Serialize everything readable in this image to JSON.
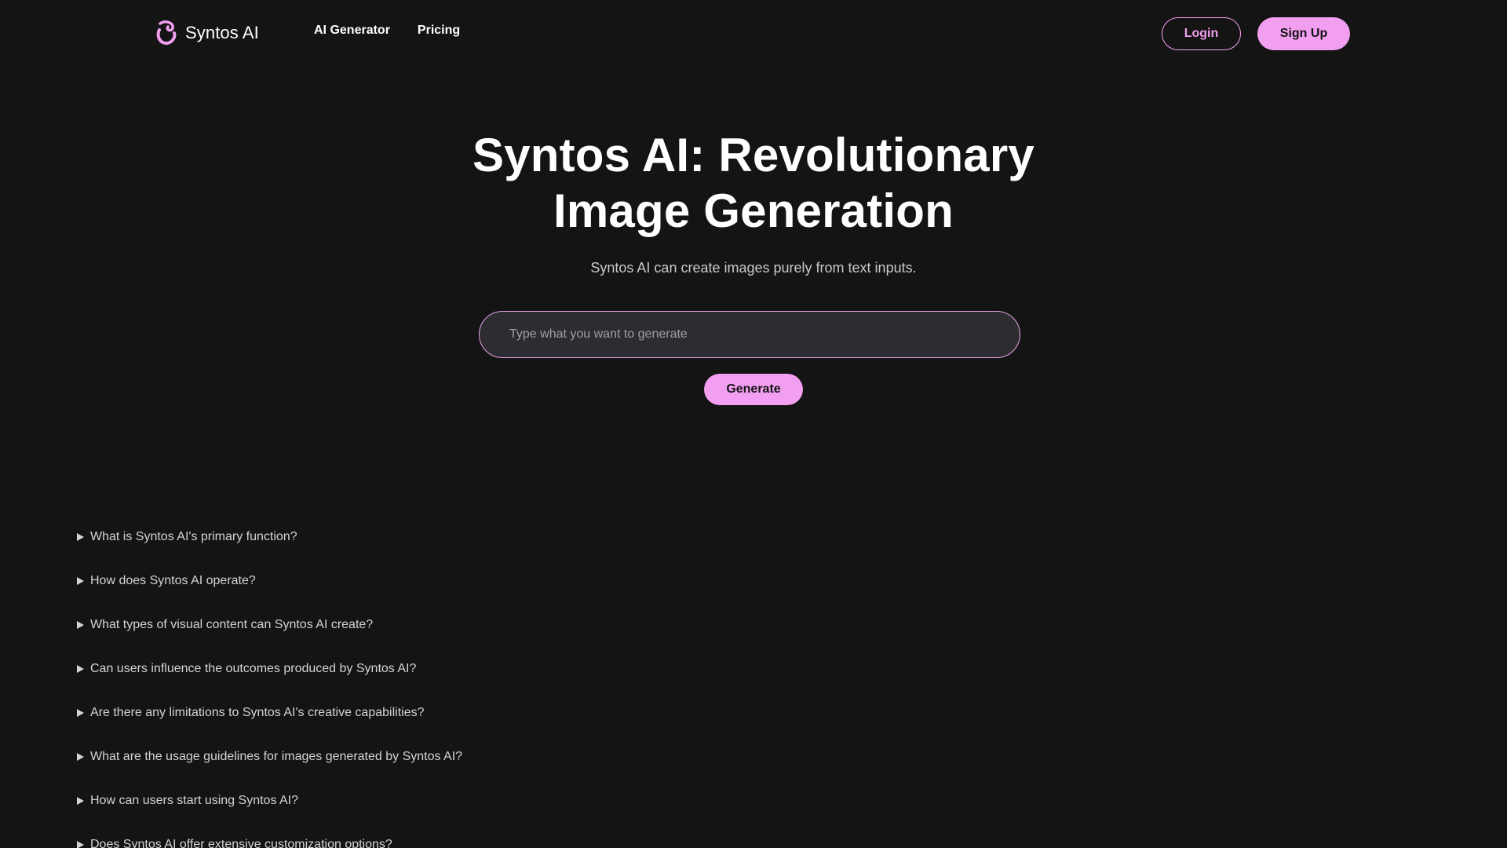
{
  "header": {
    "logo_text": "Syntos AI",
    "nav": [
      {
        "label": "AI Generator"
      },
      {
        "label": "Pricing"
      }
    ],
    "login_label": "Login",
    "signup_label": "Sign Up"
  },
  "hero": {
    "title_line1": "Syntos AI: Revolutionary",
    "title_line2": "Image Generation",
    "subtitle": "Syntos AI can create images purely from text inputs.",
    "prompt_placeholder": "Type what you want to generate",
    "prompt_value": "",
    "generate_label": "Generate"
  },
  "faq": [
    {
      "question": "What is Syntos AI's primary function?"
    },
    {
      "question": "How does Syntos AI operate?"
    },
    {
      "question": "What types of visual content can Syntos AI create?"
    },
    {
      "question": "Can users influence the outcomes produced by Syntos AI?"
    },
    {
      "question": "Are there any limitations to Syntos AI's creative capabilities?"
    },
    {
      "question": "What are the usage guidelines for images generated by Syntos AI?"
    },
    {
      "question": "How can users start using Syntos AI?"
    },
    {
      "question": "Does Syntos AI offer extensive customization options?"
    }
  ],
  "colors": {
    "background": "#141414",
    "accent": "#f39ff1",
    "input_bg": "#2d2c31"
  },
  "icons": {
    "logo": "swirl-logo-icon",
    "faq_marker": "triangle-right-icon"
  }
}
